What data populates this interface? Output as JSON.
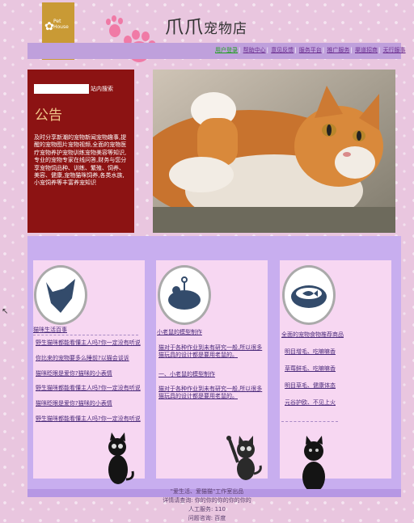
{
  "header": {
    "logo_text_1": "Pet",
    "logo_text_2": "House",
    "brand_big": "爪爪",
    "brand_small": "宠物店",
    "nav": [
      "用户登录",
      "帮助中心",
      "意见反馈",
      "服务平台",
      "推广服务",
      "渠道招商",
      "无行服事"
    ]
  },
  "notice": {
    "search_label": "站内搜索",
    "title": "公告",
    "body": "及时分享新潮的宠物新闻宠物趣事,提醒的宠物图片宠物视频,全面的宠物医疗宠物养护宠物训练宠物美容等知识,专业的宠物专家在线问答,财务与您分享宠物饲品种、训练、繁殖、饲养、美容、健康,宠物猫咪饲养,各类水族,小宠饲养等丰富养宠知识"
  },
  "columns": [
    {
      "title": "猫咪生活百事",
      "items": [
        "野生猫咪都能看懂主人吗?你一定没有听说",
        "你比来的宠物要多么睡前?以猫会谈诉",
        "猫咪眨眼是爱你?猫咪的小表情",
        "野生猫咪都能看懂主人吗?你一定没有听说",
        "猫咪眨眼是爱你?猫咪的小表情",
        "野生猫咪都能看懂主人吗?你一定没有听说"
      ]
    },
    {
      "title": "小老鼠的模型制作",
      "items": [
        "猫对于各种作业到未有研究一般,所以很多猫玩具的设计都是要用老鼠的。",
        "一、小老鼠的模型制作",
        "猫对于各种作业到未有研究一般,所以很多猫玩具的设计都是要用老鼠的。"
      ]
    },
    {
      "title": "全面的宠物食物推荐商品",
      "items": [
        "明目增毛、吃嘛嘛香",
        "草莓鲜毛、吃嘛嘛香",
        "明目草毛、健康体态",
        "元谷护欧、不见上火"
      ]
    }
  ],
  "footer": {
    "line1": "\"爱生活、爱猫猫\"工作室出品",
    "line2": "详情请查询: 你的你的你的你的你的",
    "line3": "人工服务: 110",
    "line4": "问题咨询: 百度"
  },
  "colors": {
    "accent": "#8c1313",
    "band": "#c8aeef",
    "nav": "#bfa0dc",
    "logo": "#c99a35"
  }
}
